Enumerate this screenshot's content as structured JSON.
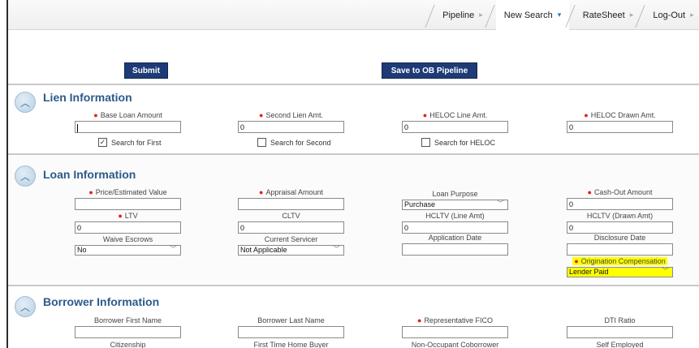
{
  "nav": {
    "tabs": [
      {
        "label": "Pipeline",
        "arrow": "▸"
      },
      {
        "label": "New Search",
        "arrow": "▾"
      },
      {
        "label": "RateSheet",
        "arrow": "▸"
      },
      {
        "label": "Log-Out",
        "arrow": "▸"
      }
    ]
  },
  "actions": {
    "submit_label": "Submit",
    "save_label": "Save to OB Pipeline"
  },
  "collapse_icon": "chevron-up-icon",
  "lien": {
    "title": "Lien Information",
    "base_loan_amount": {
      "label": "Base Loan Amount",
      "value": ""
    },
    "second_lien_amt": {
      "label": "Second Lien Amt.",
      "value": "0"
    },
    "heloc_line_amt": {
      "label": "HELOC Line Amt.",
      "value": "0"
    },
    "heloc_drawn_amt": {
      "label": "HELOC Drawn Amt.",
      "value": "0"
    },
    "search_first": {
      "label": "Search for First",
      "checked": true
    },
    "search_second": {
      "label": "Search for Second",
      "checked": false
    },
    "search_heloc": {
      "label": "Search for HELOC",
      "checked": false
    }
  },
  "loan": {
    "title": "Loan Information",
    "price_value": {
      "label": "Price/Estimated Value",
      "value": ""
    },
    "appraisal_amount": {
      "label": "Appraisal Amount",
      "value": ""
    },
    "loan_purpose": {
      "label": "Loan Purpose",
      "value": "Purchase"
    },
    "cash_out_amount": {
      "label": "Cash-Out Amount",
      "value": "0"
    },
    "ltv": {
      "label": "LTV",
      "value": "0"
    },
    "cltv": {
      "label": "CLTV",
      "value": "0"
    },
    "hcltv_line": {
      "label": "HCLTV (Line Amt)",
      "value": "0"
    },
    "hcltv_drawn": {
      "label": "HCLTV (Drawn Amt)",
      "value": "0"
    },
    "waive_escrows": {
      "label": "Waive Escrows",
      "value": "No"
    },
    "current_servicer": {
      "label": "Current Servicer",
      "value": "Not Applicable"
    },
    "application_date": {
      "label": "Application Date",
      "value": ""
    },
    "disclosure_date": {
      "label": "Disclosure Date",
      "value": ""
    },
    "origination_comp": {
      "label": "Origination Compensation",
      "value": "Lender Paid"
    }
  },
  "borrower": {
    "title": "Borrower Information",
    "first_name": {
      "label": "Borrower First Name",
      "value": ""
    },
    "last_name": {
      "label": "Borrower Last Name",
      "value": ""
    },
    "fico": {
      "label": "Representative FICO",
      "value": ""
    },
    "dti": {
      "label": "DTI Ratio",
      "value": ""
    },
    "citizenship_label": "Citizenship",
    "first_time_label": "First Time Home Buyer",
    "non_occupant_label": "Non-Occupant Coborrower",
    "self_employed_label": "Self Employed"
  },
  "colors": {
    "highlight": "#ffff00",
    "section_title": "#2c5a8c",
    "button": "#1e3b77",
    "required": "#e02020"
  }
}
